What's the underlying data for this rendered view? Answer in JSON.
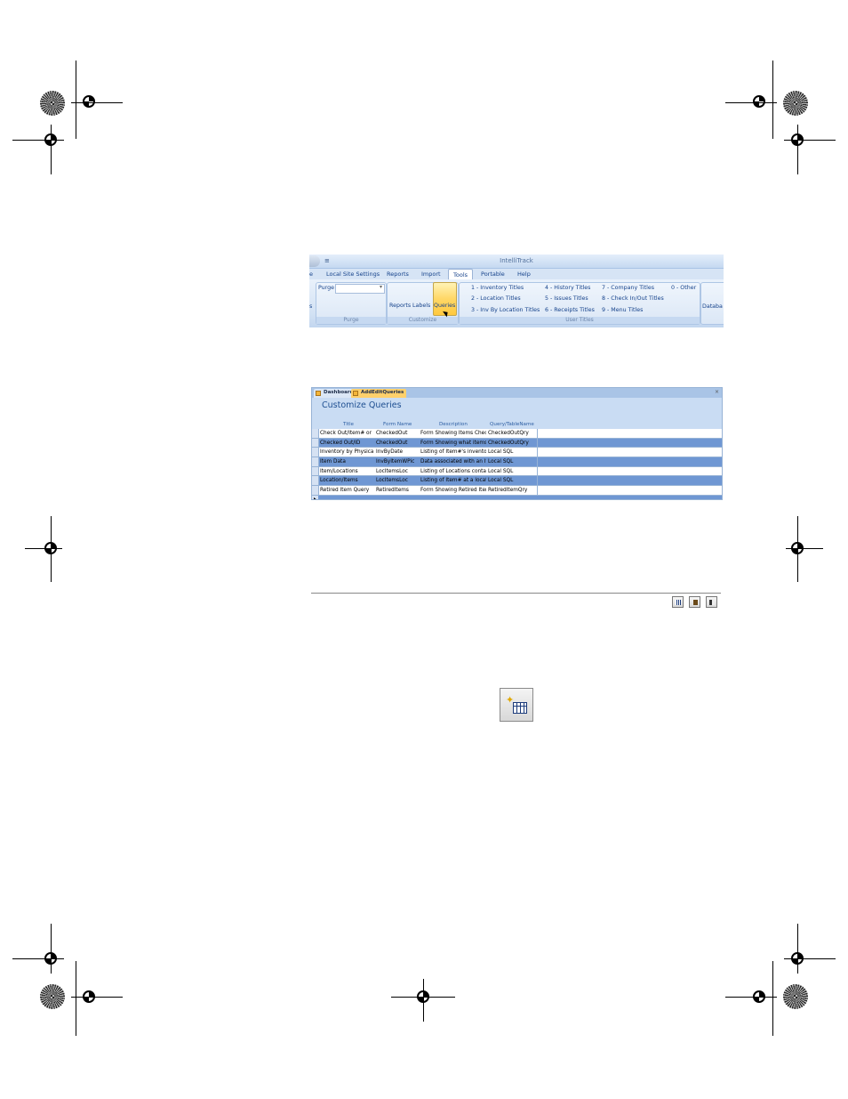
{
  "ribbon": {
    "app_title": "IntelliTrack",
    "qat_symbol": "≡",
    "tabs": [
      "e",
      "Local Site Settings",
      "Reports",
      "Import",
      "Tools",
      "Portable",
      "Help"
    ],
    "active_tab": "Tools",
    "purge_group": {
      "label": "Purge",
      "field_label": "Purge"
    },
    "customize_group": {
      "label": "Customize",
      "buttons": [
        "Reports",
        "Labels",
        "Queries"
      ]
    },
    "user_titles_group": {
      "label": "User Titles",
      "items": [
        "1 - Inventory Titles",
        "2 - Location Titles",
        "3 - Inv By Location Titles",
        "4 - History Titles",
        "5 - Issues Titles",
        "6 - Receipts Titles",
        "7 - Company Titles",
        "8 - Check In/Out Titles",
        "9 - Menu Titles",
        "0 - Other"
      ]
    },
    "right_cut_label": "Databa",
    "left_cut_label": "s"
  },
  "form": {
    "doc_tabs": [
      "Dashboard",
      "AddEditQueries"
    ],
    "close_symbol": "×",
    "title": "Customize Queries",
    "columns": [
      "Title",
      "Form Name",
      "Description",
      "Query/TableName"
    ],
    "rows": [
      {
        "title": "Check Out/Item# or Ite",
        "form": "CheckedOut",
        "desc": "Form Showing Items Check",
        "query": "CheckedOutQry",
        "style": "plain"
      },
      {
        "title": "Checked Out/ID",
        "form": "CheckedOut",
        "desc": "Form Showing what items",
        "query": "CheckedOutQry",
        "style": "alt"
      },
      {
        "title": "Inventory by Physical Ent",
        "form": "InvByDate",
        "desc": "Listing of Item#'s inventori",
        "query": "Local SQL",
        "style": "plain"
      },
      {
        "title": "Item Data",
        "form": "InvByItemWPic",
        "desc": "Data associated with an Ite",
        "query": "Local SQL",
        "style": "alt"
      },
      {
        "title": "Item/Locations",
        "form": "LocItemsLoc",
        "desc": "Listing of Locations contair",
        "query": "Local SQL",
        "style": "plain"
      },
      {
        "title": "Location/Items",
        "form": "LocItemsLoc",
        "desc": "Listing of Item# at a locatio",
        "query": "Local SQL",
        "style": "alt"
      },
      {
        "title": "Retired Item Query",
        "form": "RetiredItems",
        "desc": "Form Showing Retired Item",
        "query": "RetiredItemQry",
        "style": "plain"
      }
    ]
  },
  "toolbar": {
    "buttons": [
      "new-query-icon",
      "delete-icon",
      "exit-icon"
    ]
  },
  "enlarged_button": {
    "icon": "new-query-icon",
    "spark": "✦"
  }
}
